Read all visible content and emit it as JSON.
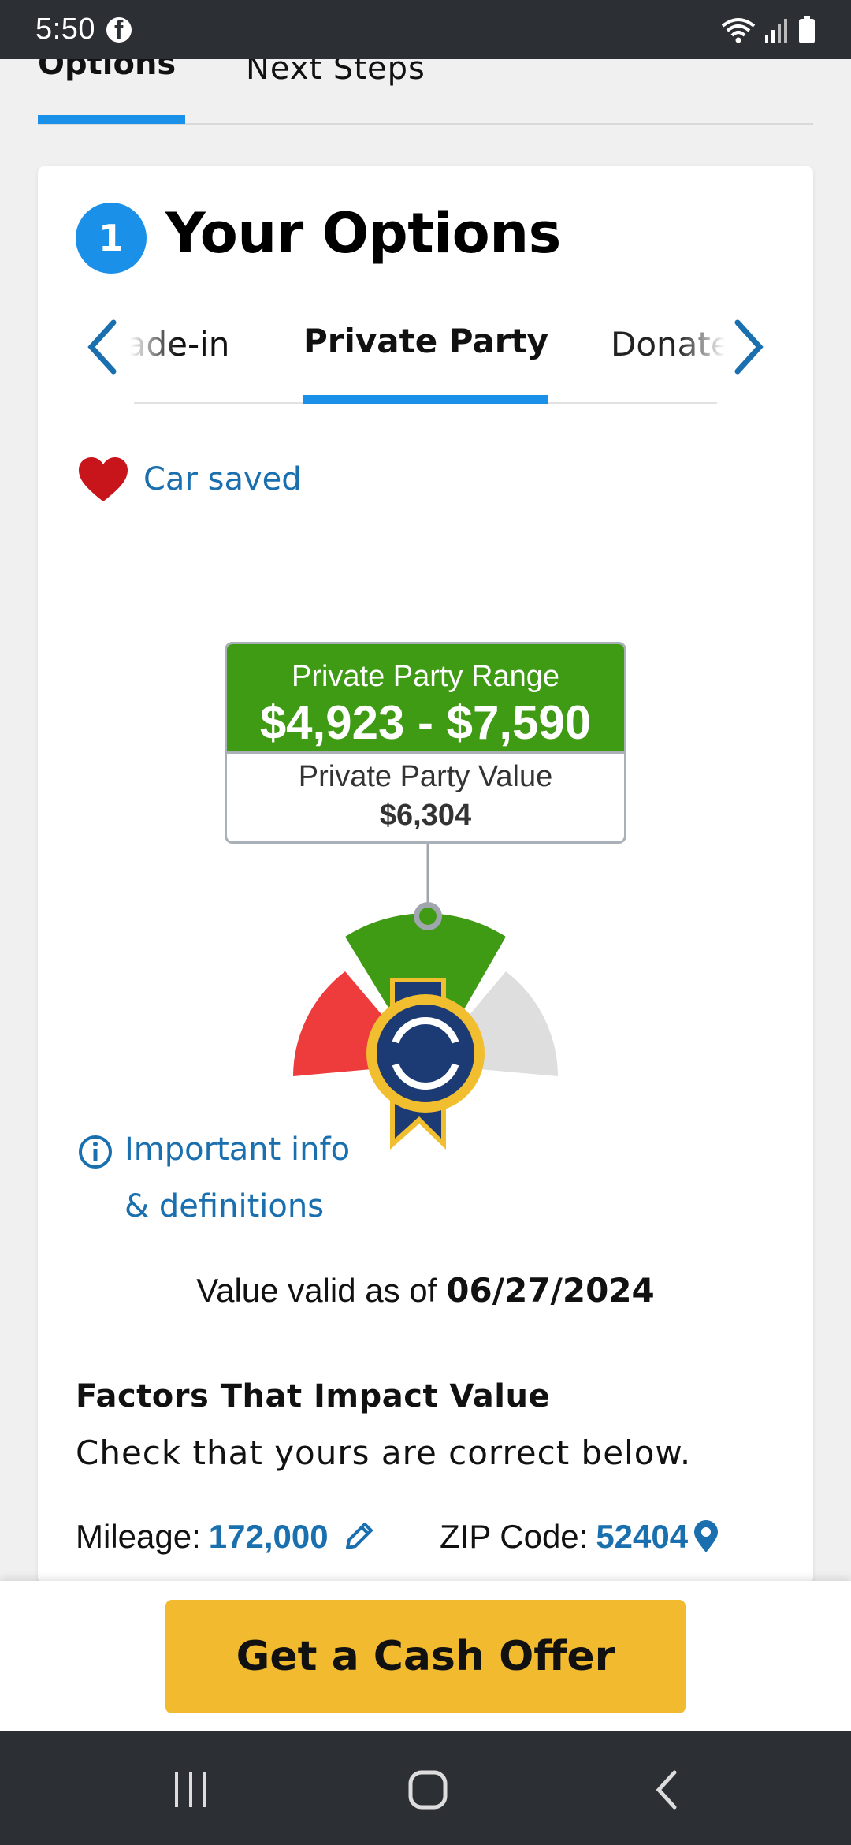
{
  "status_bar": {
    "time": "5:50"
  },
  "top_tabs": {
    "options": "Options",
    "next_steps": "Next Steps"
  },
  "section": {
    "step_number": "1",
    "title": "Your Options"
  },
  "sub_tabs": {
    "trade_in": "Trade-in",
    "private_party": "Private Party",
    "donate": "Donate",
    "active": "Private Party"
  },
  "saved": {
    "label": "Car saved"
  },
  "valuation": {
    "range_label": "Private Party Range",
    "range_value": "$4,923 - $7,590",
    "value_label": "Private Party Value",
    "value_amount": "$6,304"
  },
  "info": {
    "link_text": "Important info & definitions"
  },
  "validity": {
    "prefix": "Value valid as of",
    "date": "06/27/2024"
  },
  "factors": {
    "title": "Factors That Impact Value",
    "subtitle": "Check that yours are correct below.",
    "mileage_label": "Mileage:",
    "mileage_value": "172,000",
    "zip_label": "ZIP Code:",
    "zip_value": "52404"
  },
  "cta": {
    "label": "Get a Cash Offer"
  },
  "colors": {
    "accent_blue": "#1a90e8",
    "link_blue": "#1a6faf",
    "range_green": "#3f9a14",
    "cta_yellow": "#f2bb2f",
    "heart_red": "#c8141b"
  },
  "icons": [
    "facebook-icon",
    "wifi-icon",
    "signal-icon",
    "battery-icon",
    "chevron-left-icon",
    "chevron-right-icon",
    "heart-icon",
    "info-icon",
    "pencil-icon",
    "map-pin-icon",
    "recent-apps-icon",
    "home-icon",
    "back-icon"
  ]
}
